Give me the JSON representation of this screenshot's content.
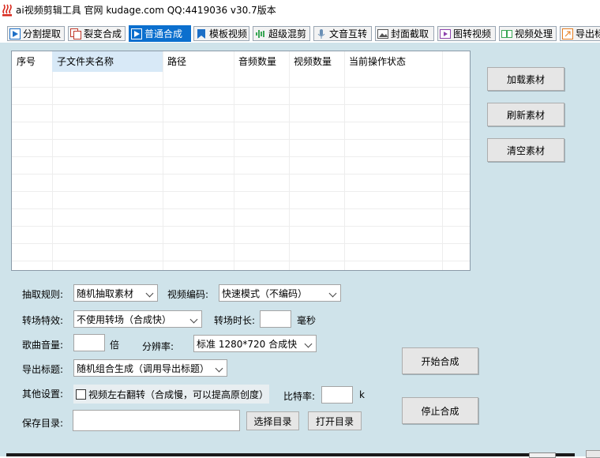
{
  "window": {
    "title": "ai视频剪辑工具 官网 kudage.com QQ:4419036    v30.7版本"
  },
  "tabs": [
    {
      "label": "分割提取",
      "icon": "play-icon"
    },
    {
      "label": "裂变合成",
      "icon": "copy-icon"
    },
    {
      "label": "普通合成",
      "icon": "play-icon",
      "active": true
    },
    {
      "label": "模板视频",
      "icon": "bookmark-icon"
    },
    {
      "label": "超级混剪",
      "icon": "soundwave-icon"
    },
    {
      "label": "文音互转",
      "icon": "microphone-icon"
    },
    {
      "label": "封面截取",
      "icon": "image-icon"
    },
    {
      "label": "图转视频",
      "icon": "slideshow-icon"
    },
    {
      "label": "视频处理",
      "icon": "video-edit-icon"
    },
    {
      "label": "导出标",
      "icon": "export-icon"
    }
  ],
  "table": {
    "columns": [
      "序号",
      "子文件夹名称",
      "路径",
      "音频数量",
      "视频数量",
      "当前操作状态"
    ]
  },
  "side_buttons": {
    "load": "加载素材",
    "refresh": "刷新素材",
    "clear": "清空素材"
  },
  "form": {
    "extract_rule_label": "抽取规则:",
    "extract_rule_value": "随机抽取素材",
    "video_codec_label": "视频编码:",
    "video_codec_value": "快速模式（不编码）",
    "transition_label": "转场特效:",
    "transition_value": "不使用转场（合成快）",
    "transition_duration_label": "转场时长:",
    "transition_duration_value": "",
    "transition_duration_unit": "毫秒",
    "music_volume_label": "歌曲音量:",
    "music_volume_value": "",
    "music_volume_unit": "倍",
    "resolution_label": "分辨率:",
    "resolution_value": "标准 1280*720 合成快",
    "export_title_label": "导出标题:",
    "export_title_value": "随机组合生成（调用导出标题）",
    "other_label": "其他设置:",
    "flip_checkbox_label": "视频左右翻转（合成慢，可以提高原创度）",
    "flip_checked": false,
    "bitrate_label": "比特率:",
    "bitrate_value": "",
    "bitrate_unit": "k",
    "save_dir_label": "保存目录:",
    "save_dir_value": "",
    "choose_dir_button": "选择目录",
    "open_dir_button": "打开目录"
  },
  "actions": {
    "start": "开始合成",
    "stop": "停止合成"
  },
  "colors": {
    "panel_bg": "#cfe3ea",
    "active_tab": "#0b6fce",
    "app_icon": "#d8281c"
  }
}
